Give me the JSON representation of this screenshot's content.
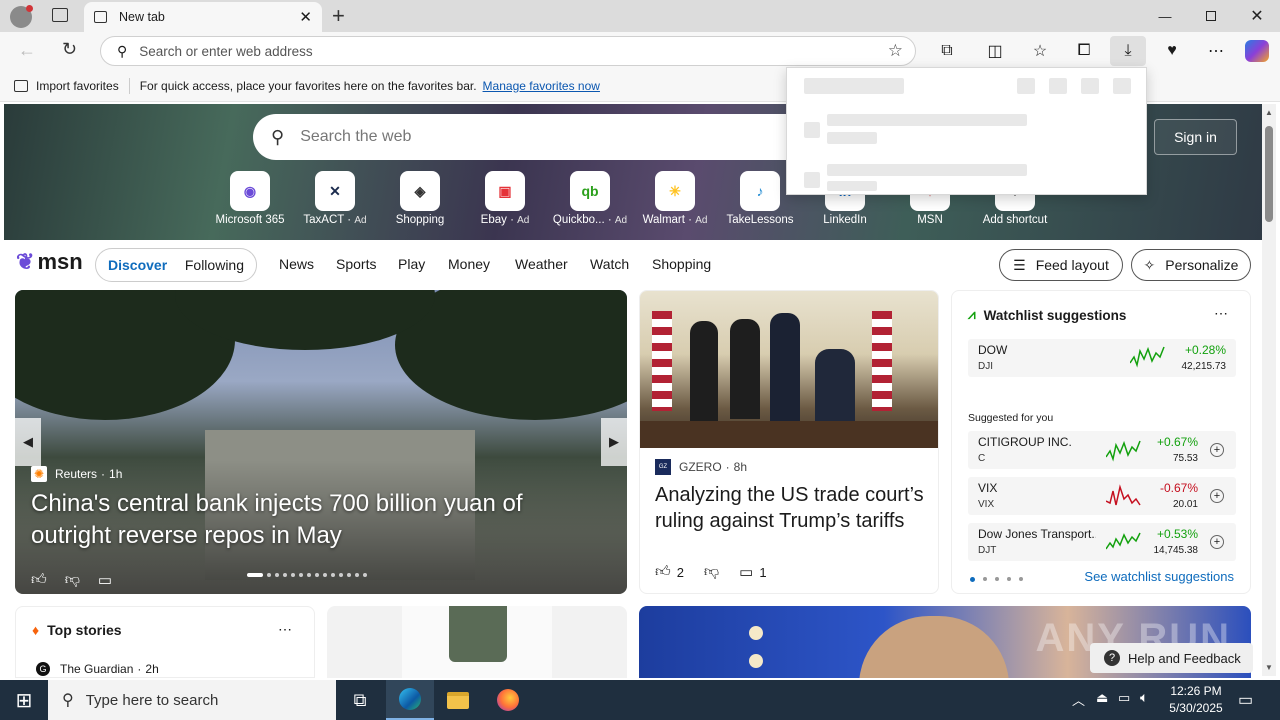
{
  "browser": {
    "tab_title": "New tab",
    "address_placeholder": "Search or enter web address"
  },
  "favorites_bar": {
    "import_label": "Import favorites",
    "message": "For quick access, place your favorites here on the favorites bar.",
    "manage_link": "Manage favorites now"
  },
  "hero": {
    "search_placeholder": "Search the web",
    "sign_in": "Sign in",
    "tiles": [
      {
        "label": "Microsoft 365",
        "ad": ""
      },
      {
        "label": "TaxACT",
        "ad": "Ad"
      },
      {
        "label": "Shopping",
        "ad": ""
      },
      {
        "label": "Ebay",
        "ad": "Ad"
      },
      {
        "label": "Quickbo...",
        "ad": "Ad"
      },
      {
        "label": "Walmart",
        "ad": "Ad"
      },
      {
        "label": "TakeLessons",
        "ad": ""
      },
      {
        "label": "LinkedIn",
        "ad": ""
      },
      {
        "label": "MSN",
        "ad": ""
      },
      {
        "label": "Add shortcut",
        "ad": ""
      }
    ]
  },
  "msn_nav": {
    "logo": "msn",
    "discover": "Discover",
    "following": "Following",
    "links": [
      "News",
      "Sports",
      "Play",
      "Money",
      "Weather",
      "Watch",
      "Shopping"
    ],
    "feed_layout": "Feed layout",
    "personalize": "Personalize"
  },
  "main_story": {
    "source": "Reuters",
    "age": "1h",
    "title": "China's central bank injects 700 billion yuan of outright reverse repos in May"
  },
  "second_story": {
    "source": "GZERO",
    "age": "8h",
    "title": "Analyzing the US trade court’s ruling against Trump’s tariffs",
    "likes": "2",
    "comments": "1"
  },
  "watchlist": {
    "title": "Watchlist suggestions",
    "suggested_label": "Suggested for you",
    "see_more": "See watchlist suggestions",
    "main": {
      "name": "DOW",
      "ticker": "DJI",
      "pct": "+0.28%",
      "value": "42,215.73"
    },
    "items": [
      {
        "name": "CITIGROUP INC.",
        "ticker": "C",
        "pct": "+0.67%",
        "value": "75.53",
        "trend": "up"
      },
      {
        "name": "VIX",
        "ticker": "VIX",
        "pct": "-0.67%",
        "value": "20.01",
        "trend": "down"
      },
      {
        "name": "Dow Jones Transport...",
        "ticker": "DJT",
        "pct": "+0.53%",
        "value": "14,745.38",
        "trend": "up"
      }
    ]
  },
  "top_stories": {
    "title": "Top stories",
    "first_source": "The Guardian",
    "first_age": "2h"
  },
  "help": {
    "label": "Help and Feedback"
  },
  "watermark": "ANY RUN",
  "taskbar": {
    "search_placeholder": "Type here to search",
    "time": "12:26 PM",
    "date": "5/30/2025"
  },
  "colors": {
    "accent": "#0f6cbd",
    "up": "#13a10e",
    "down": "#c50f1f"
  }
}
